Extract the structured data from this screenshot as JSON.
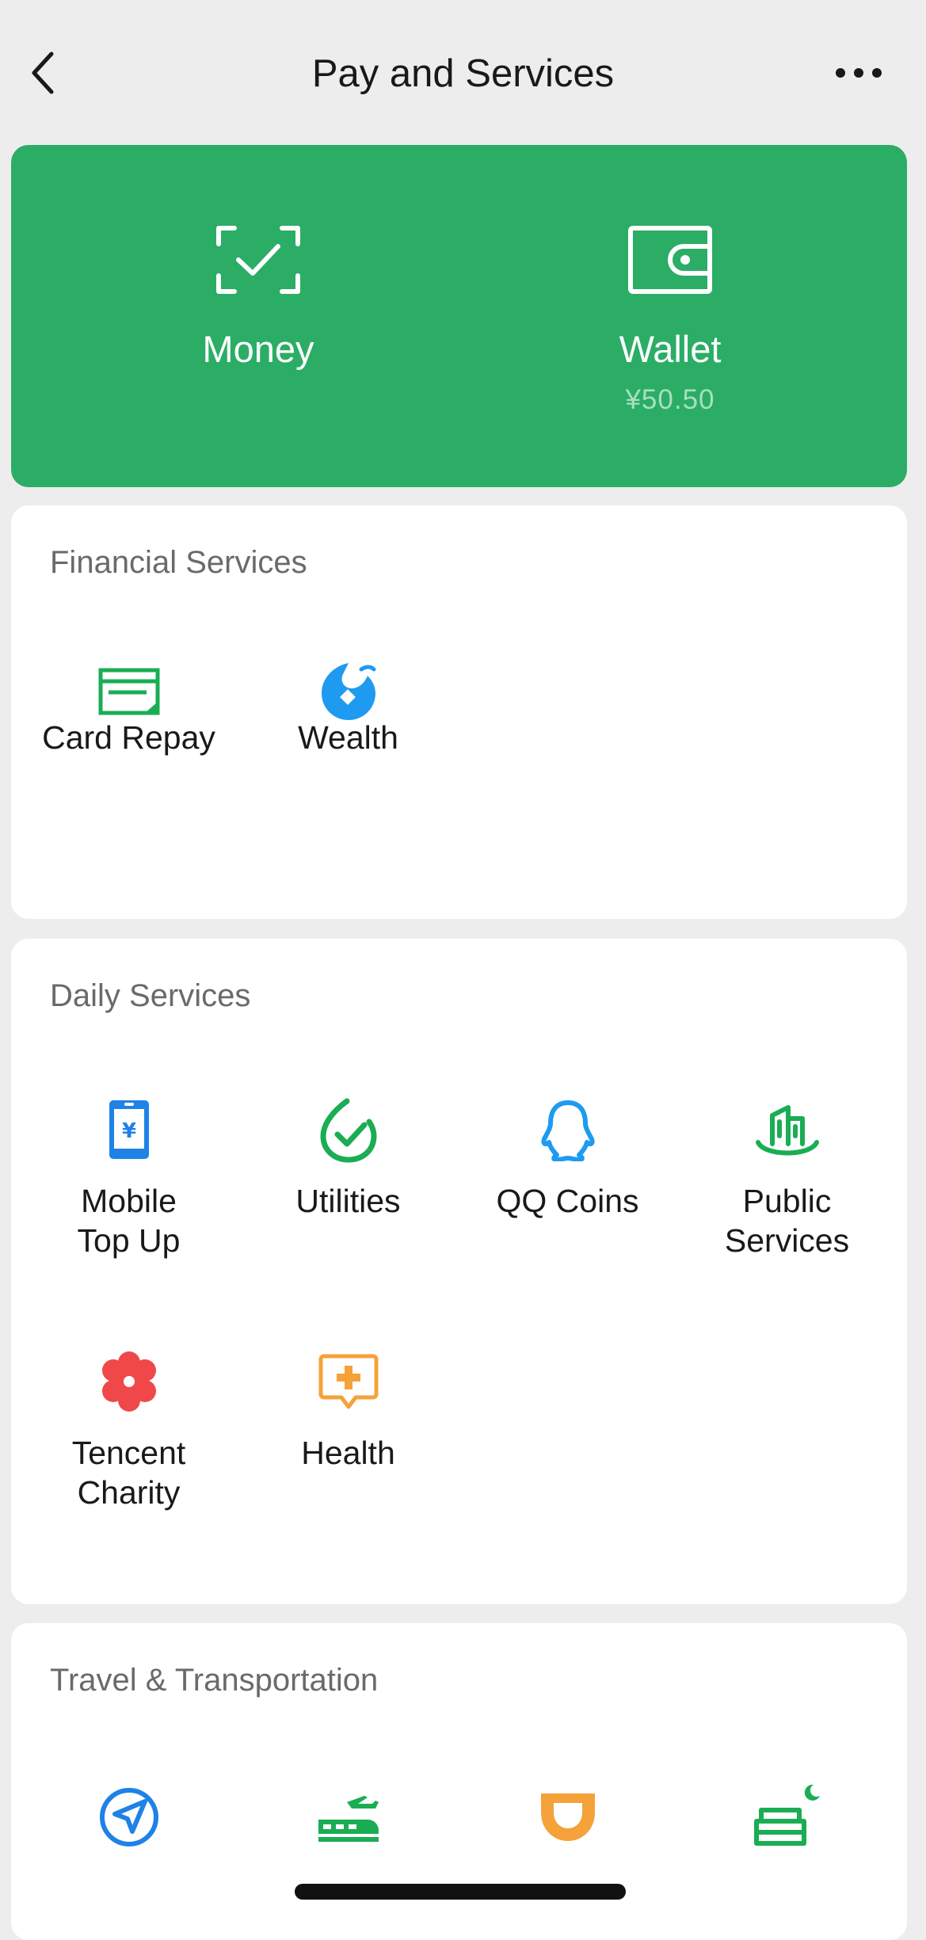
{
  "header": {
    "title": "Pay and Services",
    "back_icon": "chevron-left-icon",
    "more_icon": "more-dots-icon"
  },
  "top_card": {
    "color": "#2bad66",
    "money": {
      "label": "Money",
      "icon": "scan-check-icon"
    },
    "wallet": {
      "label": "Wallet",
      "balance": "¥50.50",
      "icon": "wallet-icon"
    }
  },
  "financial": {
    "title": "Financial Services",
    "items": [
      {
        "label": "Card Repay",
        "icon": "card-repay-icon",
        "color": "#1aad54"
      },
      {
        "label": "Wealth",
        "icon": "wealth-icon",
        "color": "#1e9bf0"
      }
    ]
  },
  "daily": {
    "title": "Daily Services",
    "items": [
      {
        "label_1": "Mobile",
        "label_2": "Top Up",
        "icon": "mobile-topup-icon",
        "color": "#1e82e6"
      },
      {
        "label_1": "Utilities",
        "label_2": "",
        "icon": "utilities-icon",
        "color": "#1aad54"
      },
      {
        "label_1": "QQ Coins",
        "label_2": "",
        "icon": "qq-penguin-icon",
        "color": "#1e9bf0"
      },
      {
        "label_1": "Public",
        "label_2": "Services",
        "icon": "public-services-icon",
        "color": "#1aad54"
      },
      {
        "label_1": "Tencent",
        "label_2": "Charity",
        "icon": "charity-flower-icon",
        "color": "#f04848"
      },
      {
        "label_1": "Health",
        "label_2": "",
        "icon": "health-icon",
        "color": "#f5a23a"
      }
    ]
  },
  "travel": {
    "title": "Travel & Transportation",
    "items": [
      {
        "icon": "navigation-arrow-icon",
        "color": "#1e82e6"
      },
      {
        "icon": "train-plane-icon",
        "color": "#1aad54"
      },
      {
        "icon": "didi-icon",
        "color": "#f5a23a"
      },
      {
        "icon": "hotel-bed-icon",
        "color": "#1aad54"
      }
    ]
  }
}
